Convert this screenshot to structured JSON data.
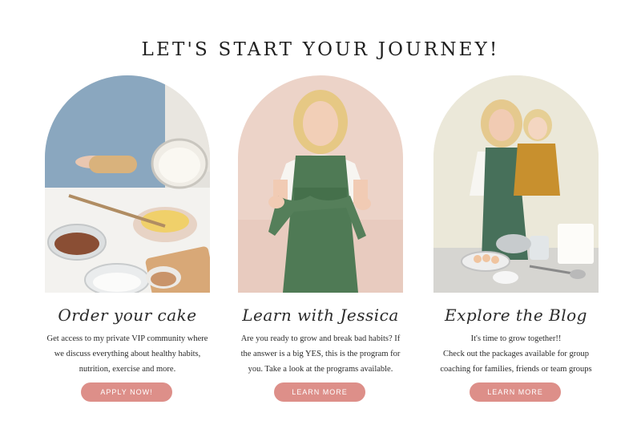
{
  "heading": "LET'S START YOUR JOURNEY!",
  "accent_color": "#dd8f89",
  "cards": [
    {
      "title": "Order your cake",
      "description": [
        "Get access to my private VIP community where",
        "we discuss everything about healthy habits,",
        "nutrition, exercise and more."
      ],
      "button": "APPLY NOW!"
    },
    {
      "title": "Learn with Jessica",
      "description": [
        "Are you ready to grow and break bad habits? If",
        "the answer is a big YES, this is the program for",
        "you. Take a look at the programs available."
      ],
      "button": "LEARN MORE"
    },
    {
      "title": "Explore the Blog",
      "description": [
        "It's time to grow together!!",
        "Check out the packages available for group",
        "coaching for families, friends or team groups"
      ],
      "button": "LEARN MORE"
    }
  ]
}
